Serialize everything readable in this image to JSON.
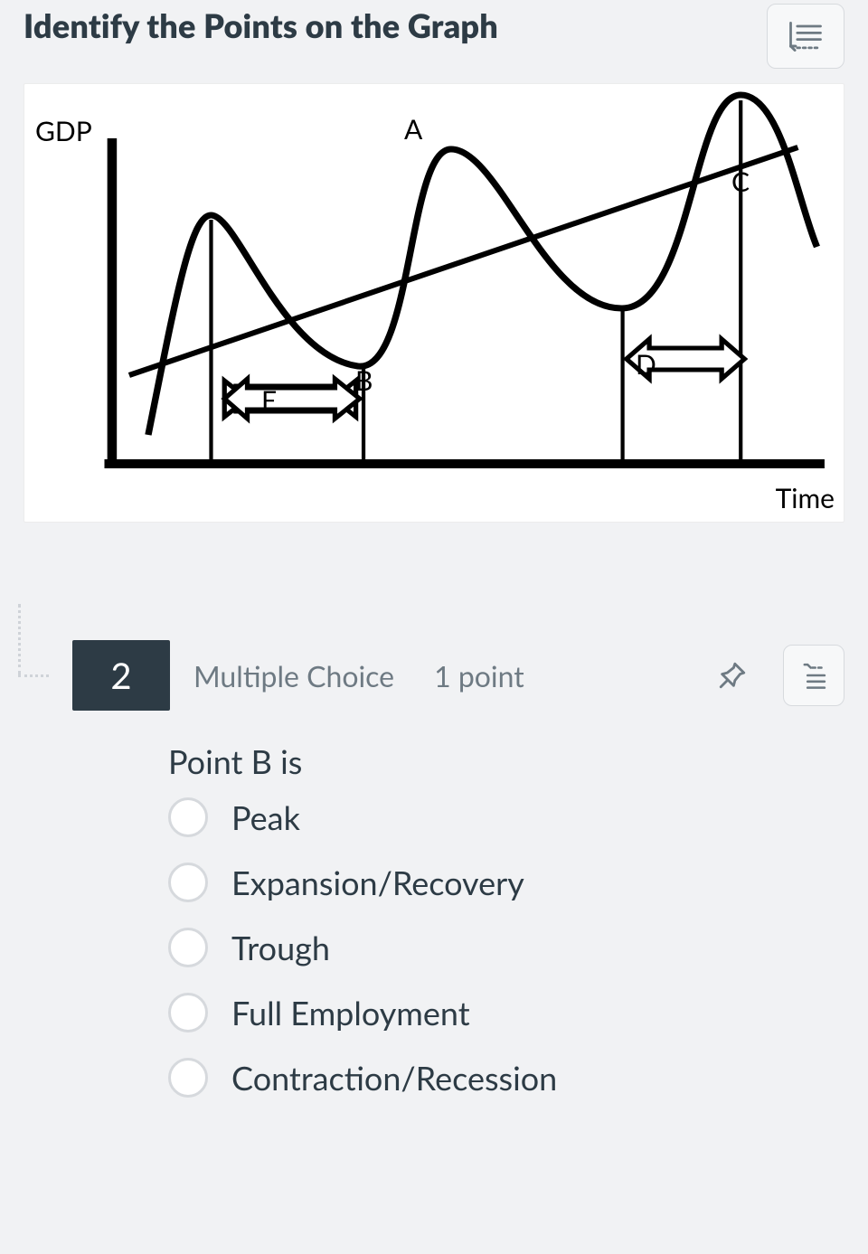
{
  "header": {
    "title": "Identify the Points on the Graph",
    "expand_icon": "chart-expand-icon"
  },
  "graph": {
    "y_label": "GDP",
    "x_label": "Time",
    "points": {
      "A": "A",
      "B": "B",
      "C": "C",
      "D": "D",
      "E": "E"
    }
  },
  "question": {
    "number": "2",
    "type": "Multiple Choice",
    "points": "1 point",
    "stem": "Point B is",
    "options": [
      "Peak",
      "Expansion/Recovery",
      "Trough",
      "Full Employment",
      "Contraction/Recession"
    ]
  }
}
